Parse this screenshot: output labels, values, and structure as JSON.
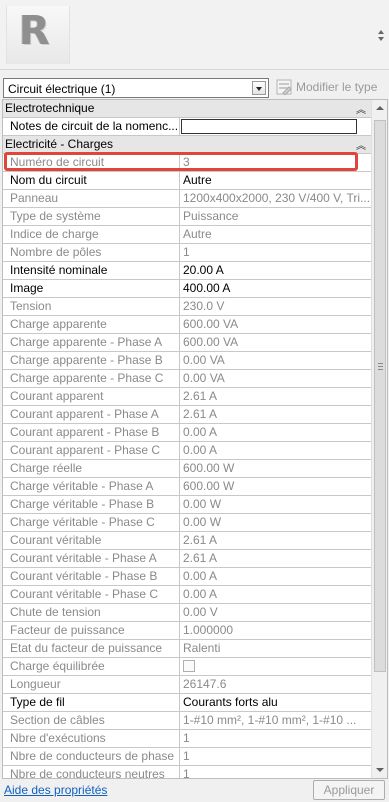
{
  "header": {
    "logo_icon": "revit-r-logo-icon"
  },
  "selector": {
    "value": "Circuit électrique (1)"
  },
  "edit_type": {
    "label": "Modifier le type",
    "icon": "edit-type-icon"
  },
  "groups": {
    "electro": "Electrotechnique",
    "loads": "Electricité - Charges"
  },
  "rows": {
    "notes": {
      "label": "Notes de circuit de la nomenc...",
      "value": ""
    },
    "circuit_number": {
      "label": "Numéro de circuit",
      "value": "3"
    },
    "circuit_name": {
      "label": "Nom du circuit",
      "value": "Autre"
    },
    "panel": {
      "label": "Panneau",
      "value": "1200x400x2000, 230 V/400 V, Tri..."
    },
    "system_type": {
      "label": "Type de système",
      "value": "Puissance"
    },
    "load_index": {
      "label": "Indice de charge",
      "value": "Autre"
    },
    "poles": {
      "label": "Nombre de pôles",
      "value": "1"
    },
    "rating": {
      "label": "Intensité nominale",
      "value": "20.00 A"
    },
    "frame": {
      "label": "Image",
      "value": "400.00 A"
    },
    "voltage": {
      "label": "Tension",
      "value": "230.0 V"
    },
    "apparent_load": {
      "label": "Charge apparente",
      "value": "600.00 VA"
    },
    "apparent_load_a": {
      "label": "Charge apparente - Phase A",
      "value": "600.00 VA"
    },
    "apparent_load_b": {
      "label": "Charge apparente - Phase B",
      "value": "0.00 VA"
    },
    "apparent_load_c": {
      "label": "Charge apparente - Phase C",
      "value": "0.00 VA"
    },
    "apparent_current": {
      "label": "Courant apparent",
      "value": "2.61 A"
    },
    "apparent_current_a": {
      "label": "Courant apparent - Phase A",
      "value": "2.61 A"
    },
    "apparent_current_b": {
      "label": "Courant apparent - Phase B",
      "value": "0.00 A"
    },
    "apparent_current_c": {
      "label": "Courant apparent - Phase C",
      "value": "0.00 A"
    },
    "true_load": {
      "label": "Charge réelle",
      "value": "600.00 W"
    },
    "true_load_a": {
      "label": "Charge véritable - Phase A",
      "value": "600.00 W"
    },
    "true_load_b": {
      "label": "Charge véritable - Phase B",
      "value": "0.00 W"
    },
    "true_load_c": {
      "label": "Charge véritable - Phase C",
      "value": "0.00 W"
    },
    "true_current": {
      "label": "Courant véritable",
      "value": "2.61 A"
    },
    "true_current_a": {
      "label": "Courant véritable - Phase A",
      "value": "2.61 A"
    },
    "true_current_b": {
      "label": "Courant véritable - Phase B",
      "value": "0.00 A"
    },
    "true_current_c": {
      "label": "Courant véritable - Phase C",
      "value": "0.00 A"
    },
    "voltage_drop": {
      "label": "Chute de tension",
      "value": "0.00 V"
    },
    "power_factor": {
      "label": "Facteur de puissance",
      "value": "1.000000"
    },
    "pf_state": {
      "label": "Etat du facteur de puissance",
      "value": "Ralenti"
    },
    "balanced": {
      "label": "Charge équilibrée",
      "checked": false
    },
    "length": {
      "label": "Longueur",
      "value": "26147.6"
    },
    "wire_type": {
      "label": "Type de fil",
      "value": "Courants forts alu"
    },
    "wire_size": {
      "label": "Section de câbles",
      "value": "1-#10 mm², 1-#10 mm², 1-#10 ..."
    },
    "runs": {
      "label": "Nbre d'exécutions",
      "value": "1"
    },
    "phase_conductors": {
      "label": "Nbre de conducteurs de phase",
      "value": "1"
    },
    "neutral_conductors": {
      "label": "Nbre de conducteurs neutres",
      "value": "1"
    }
  },
  "footer": {
    "help_link": "Aide des propriétés",
    "apply_label": "Appliquer"
  },
  "colors": {
    "highlight": "#e0453c",
    "link": "#1060c0",
    "disabled_text": "#8a8a8a"
  }
}
